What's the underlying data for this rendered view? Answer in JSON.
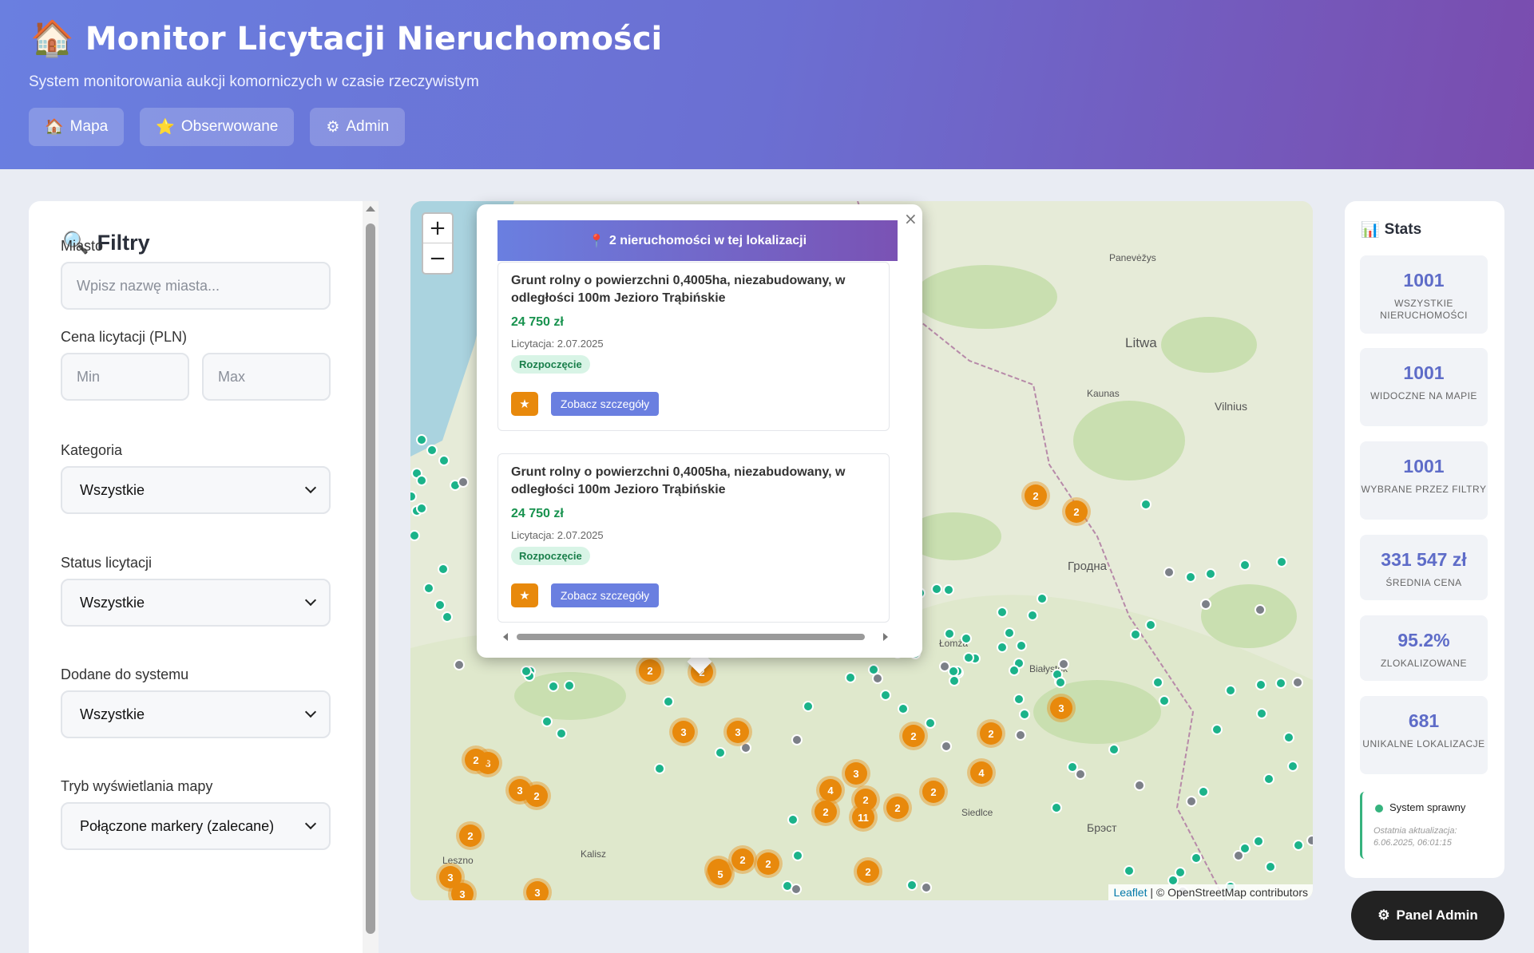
{
  "header": {
    "title": "Monitor Licytacji Nieruchomości",
    "subtitle": "System monitorowania aukcji komorniczych w czasie rzeczywistym",
    "nav": [
      {
        "icon": "house-icon",
        "label": "Mapa"
      },
      {
        "icon": "star-icon",
        "label": "Obserwowane"
      },
      {
        "icon": "gear-icon",
        "label": "Admin"
      }
    ]
  },
  "filters": {
    "title": "Filtry",
    "city_label": "Miasto",
    "city_placeholder": "Wpisz nazwę miasta...",
    "price_label": "Cena licytacji (PLN)",
    "price_min_placeholder": "Min",
    "price_max_placeholder": "Max",
    "category_label": "Kategoria",
    "category_value": "Wszystkie",
    "status_label": "Status licytacji",
    "status_value": "Wszystkie",
    "added_label": "Dodane do systemu",
    "added_value": "Wszystkie",
    "mode_label": "Tryb wyświetlania mapy",
    "mode_value": "Połączone markery (zalecane)"
  },
  "map": {
    "zoom_in": "+",
    "zoom_out": "−",
    "attribution_link": "Leaflet",
    "attribution_text": "| © OpenStreetMap contributors",
    "labels": [
      "Litwa",
      "Kaunas",
      "Vilnius",
      "Panevėžys",
      "Гродна",
      "Łomża",
      "Białystok",
      "Siedlce",
      "Брэст",
      "Kalisz",
      "Leszno"
    ],
    "popup": {
      "close": "×",
      "header": "2 nieruchomości w tej lokalizacji",
      "cards": [
        {
          "title": "Grunt rolny o powierzchni 0,4005ha, niezabudowany, w odległości 100m Jezioro Trąbińskie",
          "price": "24 750 zł",
          "date": "Licytacja: 2.07.2025",
          "status": "Rozpoczęcie",
          "details_label": "Zobacz szczegóły"
        },
        {
          "title": "Grunt rolny o powierzchni 0,4005ha, niezabudowany, w odległości 100m Jezioro Trąbińskie",
          "price": "24 750 zł",
          "date": "Licytacja: 2.07.2025",
          "status": "Rozpoczęcie",
          "details_label": "Zobacz szczegóły"
        }
      ]
    }
  },
  "stats": {
    "title": "Stats",
    "items": [
      {
        "value": "1001",
        "label": "WSZYSTKIE NIERUCHOMOŚCI"
      },
      {
        "value": "1001",
        "label": "WIDOCZNE NA MAPIE"
      },
      {
        "value": "1001",
        "label": "WYBRANE PRZEZ FILTRY"
      },
      {
        "value": "331 547 zł",
        "label": "ŚREDNIA CENA"
      },
      {
        "value": "95.2%",
        "label": "ZLOKALIZOWANE"
      },
      {
        "value": "681",
        "label": "UNIKALNE LOKALIZACJE"
      }
    ],
    "system_status": "System sprawny",
    "last_update": "Ostatnia aktualizacja: 6.06.2025, 06:01:15"
  },
  "admin_button": "Panel Admin",
  "colors": {
    "accent": "#6a7fe0",
    "cluster": "#e8890c",
    "marker": "#1bb38a",
    "price": "#17924e"
  }
}
